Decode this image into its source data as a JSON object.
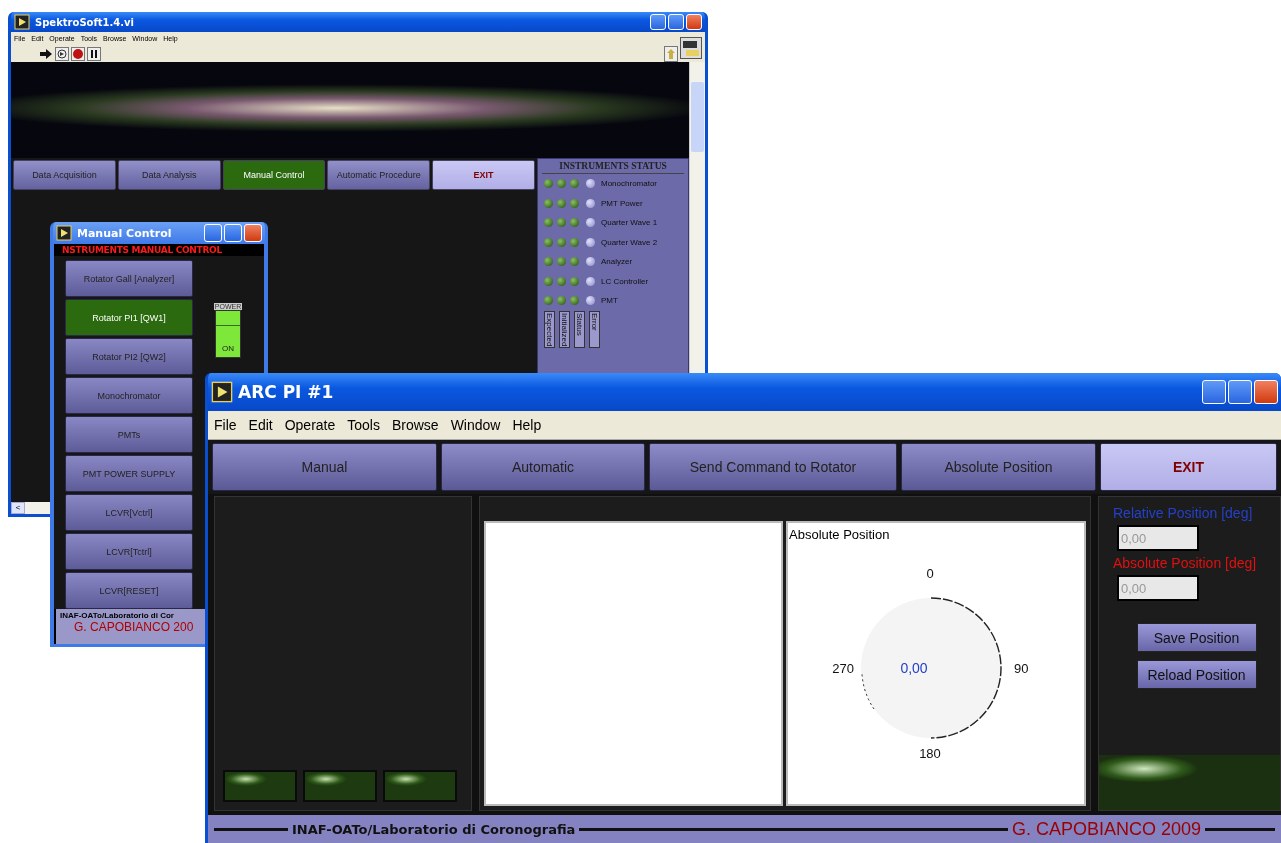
{
  "main_window": {
    "title": "SpektroSoft1.4.vi",
    "menu": [
      "File",
      "Edit",
      "Operate",
      "Tools",
      "Browse",
      "Window",
      "Help"
    ],
    "nav": [
      {
        "label": "Data Acquisition",
        "selected": false,
        "kind": "normal"
      },
      {
        "label": "Data Analysis",
        "selected": false,
        "kind": "normal"
      },
      {
        "label": "Manual Control",
        "selected": true,
        "kind": "normal"
      },
      {
        "label": "Automatic Procedure",
        "selected": false,
        "kind": "normal"
      },
      {
        "label": "EXIT",
        "selected": false,
        "kind": "exit"
      }
    ],
    "status_panel": {
      "title": "INSTRUMENTS STATUS",
      "rows": [
        "Monochromator",
        "PMT Power",
        "Quarter Wave 1",
        "Quarter Wave 2",
        "Analyzer",
        "LC Controller",
        "PMT"
      ],
      "columns": [
        "Expected",
        "Initialized",
        "Status",
        "Error"
      ]
    },
    "scroll_arrow": "<"
  },
  "manual_window": {
    "title": "Manual Control",
    "header": "NSTRUMENTS  MANUAL CONTROL",
    "buttons": [
      {
        "label": "Rotator Gall [Analyzer]",
        "selected": false
      },
      {
        "label": "Rotator PI1 [QW1]",
        "selected": true
      },
      {
        "label": "Rotator PI2 [QW2]",
        "selected": false
      },
      {
        "label": "Monochromator",
        "selected": false
      },
      {
        "label": "PMTs",
        "selected": false
      },
      {
        "label": "PMT POWER SUPPLY",
        "selected": false
      },
      {
        "label": "LCVR[Vctrl]",
        "selected": false
      },
      {
        "label": "LCVR[Tctrl]",
        "selected": false
      },
      {
        "label": "LCVR[RESET]",
        "selected": false
      }
    ],
    "power": {
      "label": "POWER",
      "state": "ON",
      "on": true
    },
    "footer": "INAF-OATo/Laboratorio di Cor",
    "author": "G. CAPOBIANCO 200"
  },
  "arc_window": {
    "title": "ARC PI #1",
    "menu": [
      "File",
      "Edit",
      "Operate",
      "Tools",
      "Browse",
      "Window",
      "Help"
    ],
    "nav": [
      {
        "label": "Manual",
        "kind": "normal"
      },
      {
        "label": "Automatic",
        "kind": "normal"
      },
      {
        "label": "Send Command to Rotator",
        "kind": "normal"
      },
      {
        "label": "Absolute Position",
        "kind": "normal"
      },
      {
        "label": "EXIT",
        "kind": "exit"
      }
    ],
    "dial": {
      "title": "Absolute Position",
      "ticks": [
        "0",
        "90",
        "180",
        "270"
      ],
      "value": "0,00"
    },
    "fields": [
      {
        "label": "Relative Position [deg]",
        "color": "#2440c8",
        "value": "0,00",
        "disabled": true
      },
      {
        "label": "Absolute Position [deg]",
        "color": "#e01010",
        "value": "0,00",
        "disabled": true
      }
    ],
    "buttons": [
      "Save Position",
      "Reload Position"
    ],
    "footer": "INAF-OATo/Laboratorio di Coronografia",
    "author": "G. CAPOBIANCO 2009"
  }
}
